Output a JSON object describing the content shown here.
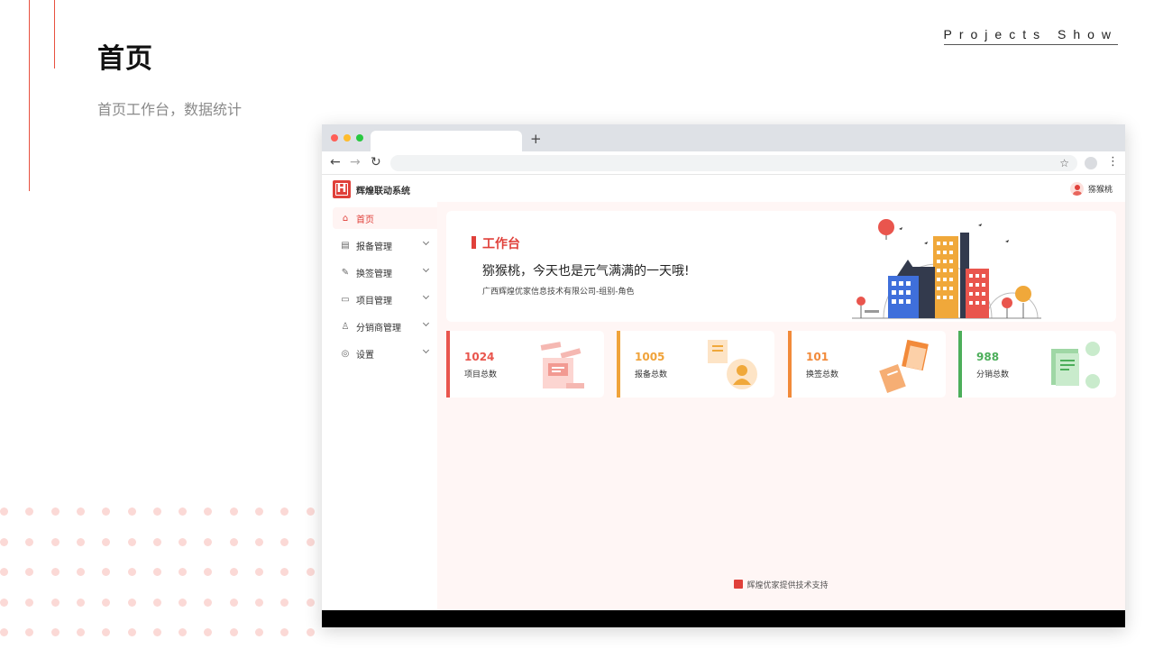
{
  "slide": {
    "title": "首页",
    "subtitle": "首页工作台，数据统计",
    "tag": "Projects Show"
  },
  "browser": {
    "new_tab": "+",
    "back": "←",
    "forward": "→",
    "reload": "↻",
    "star": "☆",
    "menu": "⋮"
  },
  "app": {
    "logo_text": "H",
    "name": "辉煌联动系统",
    "user": "猕猴桃"
  },
  "sidebar": {
    "items": [
      {
        "label": "首页",
        "icon": "home-icon",
        "glyph": "⌂",
        "active": true
      },
      {
        "label": "报备管理",
        "icon": "document-icon",
        "glyph": "▤",
        "active": false
      },
      {
        "label": "换签管理",
        "icon": "edit-doc-icon",
        "glyph": "✎",
        "active": false
      },
      {
        "label": "项目管理",
        "icon": "folder-icon",
        "glyph": "▭",
        "active": false
      },
      {
        "label": "分销商管理",
        "icon": "person-icon",
        "glyph": "♙",
        "active": false
      },
      {
        "label": "设置",
        "icon": "settings-icon",
        "glyph": "◎",
        "active": false
      }
    ]
  },
  "welcome": {
    "title": "工作台",
    "greeting": "猕猴桃，今天也是元气满满的一天哦!",
    "org": "广西辉煌优家信息技术有限公司-组别-角色"
  },
  "stats": [
    {
      "value": "1024",
      "label": "项目总数",
      "color": "#e9554d"
    },
    {
      "value": "1005",
      "label": "报备总数",
      "color": "#f0a33a"
    },
    {
      "value": "101",
      "label": "换签总数",
      "color": "#f28a3a"
    },
    {
      "value": "988",
      "label": "分销总数",
      "color": "#4cae5a"
    }
  ],
  "footer": {
    "text": "辉煌优家提供技术支持"
  },
  "colors": {
    "accent": "#e0403a",
    "main_bg": "#fff6f5",
    "dots": "#fbd9d6"
  }
}
